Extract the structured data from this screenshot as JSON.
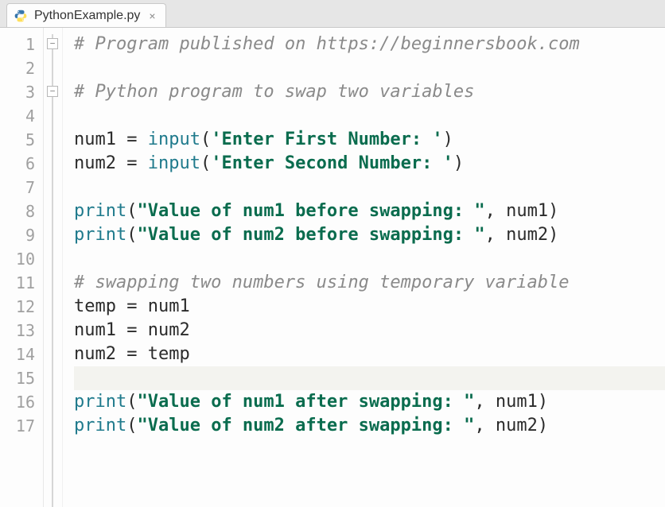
{
  "tab": {
    "filename": "PythonExample.py",
    "close_tooltip": "Close",
    "icon_name": "python-file-icon"
  },
  "editor": {
    "highlighted_line": 15,
    "fold_marks": [
      {
        "line": 1,
        "symbol": "−"
      },
      {
        "line": 3,
        "symbol": "−"
      }
    ],
    "line_count": 17,
    "lines": [
      {
        "n": 1,
        "tokens": [
          {
            "t": "# Program published on https://beginnersbook.com",
            "cls": "c"
          }
        ]
      },
      {
        "n": 2,
        "tokens": []
      },
      {
        "n": 3,
        "tokens": [
          {
            "t": "# Python program to swap two variables",
            "cls": "c"
          }
        ]
      },
      {
        "n": 4,
        "tokens": []
      },
      {
        "n": 5,
        "tokens": [
          {
            "t": "num1 ",
            "cls": "nm"
          },
          {
            "t": "= ",
            "cls": "op"
          },
          {
            "t": "input",
            "cls": "kw"
          },
          {
            "t": "(",
            "cls": "pn"
          },
          {
            "t": "'Enter First Number: '",
            "cls": "str"
          },
          {
            "t": ")",
            "cls": "pn"
          }
        ]
      },
      {
        "n": 6,
        "tokens": [
          {
            "t": "num2 ",
            "cls": "nm"
          },
          {
            "t": "= ",
            "cls": "op"
          },
          {
            "t": "input",
            "cls": "kw"
          },
          {
            "t": "(",
            "cls": "pn"
          },
          {
            "t": "'Enter Second Number: '",
            "cls": "str"
          },
          {
            "t": ")",
            "cls": "pn"
          }
        ]
      },
      {
        "n": 7,
        "tokens": []
      },
      {
        "n": 8,
        "tokens": [
          {
            "t": "print",
            "cls": "kw"
          },
          {
            "t": "(",
            "cls": "pn"
          },
          {
            "t": "\"Value of num1 before swapping: \"",
            "cls": "str"
          },
          {
            "t": ", ",
            "cls": "pn"
          },
          {
            "t": "num1",
            "cls": "nm"
          },
          {
            "t": ")",
            "cls": "pn"
          }
        ]
      },
      {
        "n": 9,
        "tokens": [
          {
            "t": "print",
            "cls": "kw"
          },
          {
            "t": "(",
            "cls": "pn"
          },
          {
            "t": "\"Value of num2 before swapping: \"",
            "cls": "str"
          },
          {
            "t": ", ",
            "cls": "pn"
          },
          {
            "t": "num2",
            "cls": "nm"
          },
          {
            "t": ")",
            "cls": "pn"
          }
        ]
      },
      {
        "n": 10,
        "tokens": []
      },
      {
        "n": 11,
        "tokens": [
          {
            "t": "# swapping two numbers using temporary variable",
            "cls": "c"
          }
        ]
      },
      {
        "n": 12,
        "tokens": [
          {
            "t": "temp ",
            "cls": "nm"
          },
          {
            "t": "= ",
            "cls": "op"
          },
          {
            "t": "num1",
            "cls": "nm"
          }
        ]
      },
      {
        "n": 13,
        "tokens": [
          {
            "t": "num1 ",
            "cls": "nm"
          },
          {
            "t": "= ",
            "cls": "op"
          },
          {
            "t": "num2",
            "cls": "nm"
          }
        ]
      },
      {
        "n": 14,
        "tokens": [
          {
            "t": "num2 ",
            "cls": "nm"
          },
          {
            "t": "= ",
            "cls": "op"
          },
          {
            "t": "temp",
            "cls": "nm"
          }
        ]
      },
      {
        "n": 15,
        "tokens": []
      },
      {
        "n": 16,
        "tokens": [
          {
            "t": "print",
            "cls": "kw"
          },
          {
            "t": "(",
            "cls": "pn"
          },
          {
            "t": "\"Value of num1 after swapping: \"",
            "cls": "str"
          },
          {
            "t": ", ",
            "cls": "pn"
          },
          {
            "t": "num1",
            "cls": "nm"
          },
          {
            "t": ")",
            "cls": "pn"
          }
        ]
      },
      {
        "n": 17,
        "tokens": [
          {
            "t": "print",
            "cls": "kw"
          },
          {
            "t": "(",
            "cls": "pn"
          },
          {
            "t": "\"Value of num2 after swapping: \"",
            "cls": "str"
          },
          {
            "t": ", ",
            "cls": "pn"
          },
          {
            "t": "num2",
            "cls": "nm"
          },
          {
            "t": ")",
            "cls": "pn"
          }
        ]
      }
    ]
  }
}
